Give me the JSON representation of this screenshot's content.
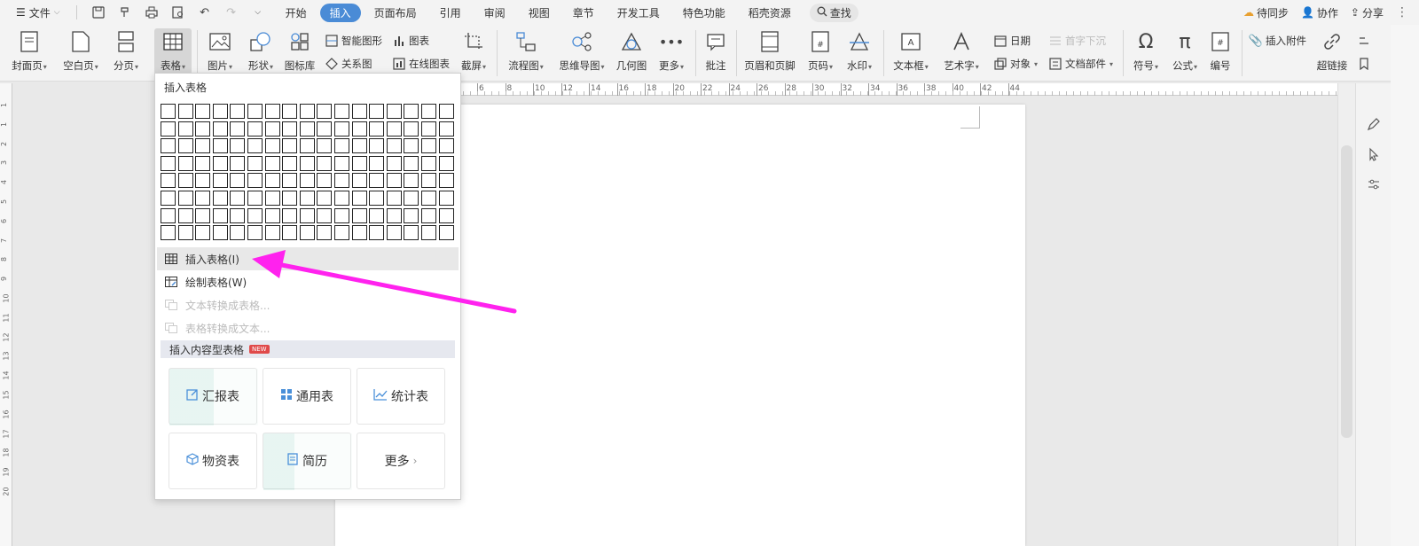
{
  "menubar": {
    "file_label": "文件",
    "tabs": [
      "开始",
      "插入",
      "页面布局",
      "引用",
      "审阅",
      "视图",
      "章节",
      "开发工具",
      "特色功能",
      "稻壳资源"
    ],
    "active_tab": "插入",
    "search_label": "查找",
    "sync_label": "待同步",
    "collab_label": "协作",
    "share_label": "分享"
  },
  "ribbon": {
    "cover_page": "封面页",
    "blank_page": "空白页",
    "page_break": "分页",
    "table": "表格",
    "picture": "图片",
    "shape": "形状",
    "icon_lib": "图标库",
    "smart_art": "智能图形",
    "relation": "关系图",
    "chart": "图表",
    "online_chart": "在线图表",
    "screenshot": "截屏",
    "flowchart": "流程图",
    "mindmap": "思维导图",
    "geometry": "几何图",
    "more": "更多",
    "comment": "批注",
    "header_footer": "页眉和页脚",
    "page_number": "页码",
    "watermark": "水印",
    "textbox": "文本框",
    "wordart": "艺术字",
    "date": "日期",
    "object": "对象",
    "first_letter": "首字下沉",
    "doc_parts": "文档部件",
    "symbol": "符号",
    "formula": "公式",
    "numbering": "编号",
    "attach": "插入附件",
    "hyperlink": "超链接"
  },
  "ruler": {
    "h_numbers": [
      "6",
      "8",
      "10",
      "12",
      "14",
      "16",
      "18",
      "20",
      "22",
      "24",
      "26",
      "28",
      "30",
      "32",
      "34",
      "36",
      "38",
      "40",
      "42",
      "44"
    ],
    "v_numbers": [
      "1",
      "1",
      "2",
      "3",
      "4",
      "5",
      "6",
      "7",
      "8",
      "9",
      "10",
      "11",
      "12",
      "13",
      "14",
      "15",
      "16",
      "17",
      "18",
      "19",
      "20"
    ]
  },
  "dropdown": {
    "header": "插入表格",
    "grid_cols": 17,
    "grid_rows": 8,
    "items": [
      {
        "label": "插入表格(I)",
        "icon": "table-icon",
        "disabled": false
      },
      {
        "label": "绘制表格(W)",
        "icon": "draw-table-icon",
        "disabled": false
      },
      {
        "label": "文本转换成表格...",
        "icon": "text-to-table-icon",
        "disabled": true
      },
      {
        "label": "表格转换成文本...",
        "icon": "table-to-text-icon",
        "disabled": true
      }
    ],
    "section_title": "插入内容型表格",
    "new_badge": "NEW",
    "templates": [
      "汇报表",
      "通用表",
      "统计表",
      "物资表",
      "简历",
      "更多"
    ]
  },
  "colors": {
    "accent": "#4a8bd6",
    "arrow": "#ff22ee",
    "template_icon": "#4a90d9",
    "new_badge": "#e04a4a"
  }
}
